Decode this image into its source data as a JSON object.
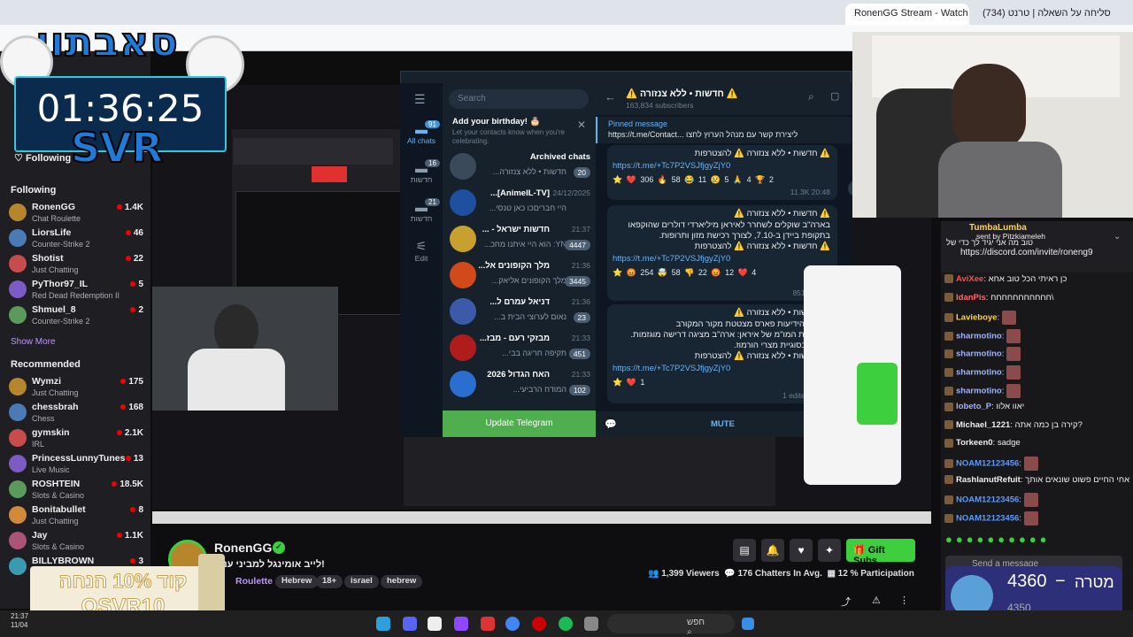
{
  "browser": {
    "tabs": [
      "RonenGG Stream - Watch Live",
      "(734) סליחה על השאלה | טרנט"
    ]
  },
  "overlay": {
    "brand": "סאבתון",
    "timer": "01:36:25",
    "svr": "SVR"
  },
  "sidebar": {
    "following_label": "Following",
    "section_following": "Following",
    "followed": [
      {
        "name": "RonenGG",
        "game": "Chat Roulette",
        "viewers": "1.4K"
      },
      {
        "name": "LiorsLife",
        "game": "Counter-Strike 2",
        "viewers": "46"
      },
      {
        "name": "Shotist",
        "game": "Just Chatting",
        "viewers": "22"
      },
      {
        "name": "PyThor97_IL",
        "game": "Red Dead Redemption II",
        "viewers": "5"
      },
      {
        "name": "Shmuel_8",
        "game": "Counter-Strike 2",
        "viewers": "2"
      }
    ],
    "show_more": "Show More",
    "section_recommended": "Recommended",
    "recommended": [
      {
        "name": "Wymzi",
        "game": "Just Chatting",
        "viewers": "175"
      },
      {
        "name": "chessbrah",
        "game": "Chess",
        "viewers": "168"
      },
      {
        "name": "gymskin",
        "game": "IRL",
        "viewers": "2.1K"
      },
      {
        "name": "PrincessLunnyTunes",
        "game": "Live Music",
        "viewers": "13"
      },
      {
        "name": "ROSHTEIN",
        "game": "Slots & Casino",
        "viewers": "18.5K"
      },
      {
        "name": "Bonitabullet",
        "game": "Just Chatting",
        "viewers": "8"
      },
      {
        "name": "Jay",
        "game": "Slots & Casino",
        "viewers": "1.1K"
      },
      {
        "name": "BILLYBROWN",
        "game": "",
        "viewers": "3"
      }
    ]
  },
  "telegram": {
    "search_placeholder": "Search",
    "rail": [
      {
        "label": "All chats",
        "badge": "91"
      },
      {
        "label": "חדשות",
        "badge": "16"
      },
      {
        "label": "חדשות",
        "badge": "21"
      },
      {
        "label": "Edit",
        "badge": ""
      }
    ],
    "birthday_title": "Add your birthday! 🎂",
    "birthday_sub": "Let your contacts know when you're celebrating.",
    "chats": [
      {
        "title": "Archived chats",
        "time": "",
        "preview": "חדשות • ללא צנזורה...",
        "badge": "20"
      },
      {
        "title": "[AnimeIL-TV]...",
        "time": "24/12/2025",
        "preview": "היי חבריםכו כאן טנסי...",
        "badge": ""
      },
      {
        "title": "חדשות ישראל - ...",
        "time": "21:37",
        "preview": "YN: הוא היי איתנו מחכ...",
        "badge": "4447"
      },
      {
        "title": "מלך הקופונים אל...",
        "time": "21:36",
        "preview": "מלך הקופונים אליאק...",
        "badge": "3445"
      },
      {
        "title": "דניאל עמרם ל...",
        "time": "21:36",
        "preview": "נאום לערוצי הבית ב...",
        "badge": "23"
      },
      {
        "title": "מבזקי רעם - מבז...",
        "time": "21:33",
        "preview": "תקיפה חריגה בבי...",
        "badge": "451"
      },
      {
        "title": "האח הגדול 2026",
        "time": "21:33",
        "preview": "המודח הרביעי...",
        "badge": "102"
      }
    ],
    "update_btn": "Update Telegram",
    "channel_title": "⚠️ חדשות • ללא צנזורה ⚠️",
    "channel_subs": "163,834 subscribers",
    "pinned_label": "Pinned message",
    "pinned_text": "https://t.me/Contact... ליצירת קשר עם מנהל הערוץ לחצו",
    "mute": "MUTE",
    "messages": [
      {
        "lines": [
          "⚠️ חדשות • ללא צנזורה ⚠️ להצטרפות"
        ],
        "link": "https://t.me/+Tc7P2VSJfjgyZjY0",
        "reactions": "⭐ ❤️ 306 🔥 58 😂 11 😢 5 🙏 4 🏆 2",
        "meta": "11.3K 20:48"
      },
      {
        "lines": [
          "⚠️ חדשות • ללא צנזורה ⚠️",
          "בארה\"ב שוקלים לשחרר לאיראן מיליארדי דולרים שהוקפאו",
          "בתקופת ביידן ב-7.10, לצורך רכישת מזון ותרופות.",
          "⚠️ חדשות • ללא צנזורה ⚠️ להצטרפות"
        ],
        "link": "https://t.me/+Tc7P2VSJfjgyZjY0",
        "reactions": "⭐ 😡 254 🤯 58 👎 22 😡 12 ❤️ 4",
        "meta": "8519 21:00"
      },
      {
        "lines": [
          "⚠️ חדשות • ללא צנזורה ⚠️",
          "סוכנות הידיעות פארס מצטטת מקור המקורב",
          "למשלחת המו\"מ של איראן: ארה\"ב מציגה דרישה מוגזמות.",
          "בעיקר בסוגיית מצרי הורמוז.",
          "⚠️ חדשות • ללא צנזורה ⚠️ להצטרפות"
        ],
        "link": "https://t.me/+Tc7P2VSJfjgyZjY0",
        "reactions": "⭐ ❤️ 1",
        "meta": "1  edited 21:36"
      }
    ]
  },
  "stream_info": {
    "channel": "RonenGG",
    "title": "לייב אומינגל למביני עניין!",
    "category": "Roulette",
    "tags": [
      "Hebrew",
      "18+",
      "israel",
      "hebrew"
    ],
    "viewers": "1,399 Viewers",
    "chatters": "176 Chatters In Avg.",
    "participation": "12 % Participation",
    "gift_subs": "Gift Subs"
  },
  "chat": {
    "pinned_user": "TumbaLumba",
    "pinned_by": "sent by Pitzkiameleh",
    "pinned_link": "https://discord.com/invite/roneng9",
    "pinned_text": "טוב מה אני יגיד לך כדי של",
    "messages": [
      {
        "user": "AviXee",
        "text": "כן ראיתי הכל טוב אחא",
        "color": "#ff4d4d"
      },
      {
        "user": "IdanPis",
        "text": "חחחחחחחחחחח\\",
        "color": "#ff6b6b"
      },
      {
        "user": "Lavieboye",
        "text": "",
        "color": "#ffd24d"
      },
      {
        "user": "sharmotino",
        "text": "",
        "color": "#9fb3ff"
      },
      {
        "user": "sharmotino",
        "text": "",
        "color": "#9fb3ff"
      },
      {
        "user": "sharmotino",
        "text": "",
        "color": "#9fb3ff"
      },
      {
        "user": "sharmotino",
        "text": "",
        "color": "#9fb3ff"
      },
      {
        "user": "lobeto_P",
        "text": "יאוו אלוו",
        "color": "#9fb3ff"
      },
      {
        "user": "Michael_1221",
        "text": "קירה בן כמה אתה?",
        "color": "#efeff1"
      },
      {
        "user": "Torkeen0",
        "text": "sadge",
        "color": "#efeff1"
      },
      {
        "user": "NOAM12123456",
        "text": "",
        "color": "#5a9bff"
      },
      {
        "user": "RashlanutRefuit",
        "text": "אחי החיים פשוט שונאים אותך",
        "color": "#efeff1"
      },
      {
        "user": "NOAM12123456",
        "text": "",
        "color": "#5a9bff"
      },
      {
        "user": "NOAM12123456",
        "text": "",
        "color": "#5a9bff"
      }
    ],
    "send_placeholder": "Send a message"
  },
  "promo": {
    "line1": "קוד 10% הנחה",
    "line2": "OSVR10"
  },
  "goal": {
    "value": "4360",
    "sep": "−",
    "label": "מטרה",
    "sub": "4350"
  },
  "taskbar": {
    "search": "חפש",
    "clock": "21:37",
    "date": "11/04"
  }
}
